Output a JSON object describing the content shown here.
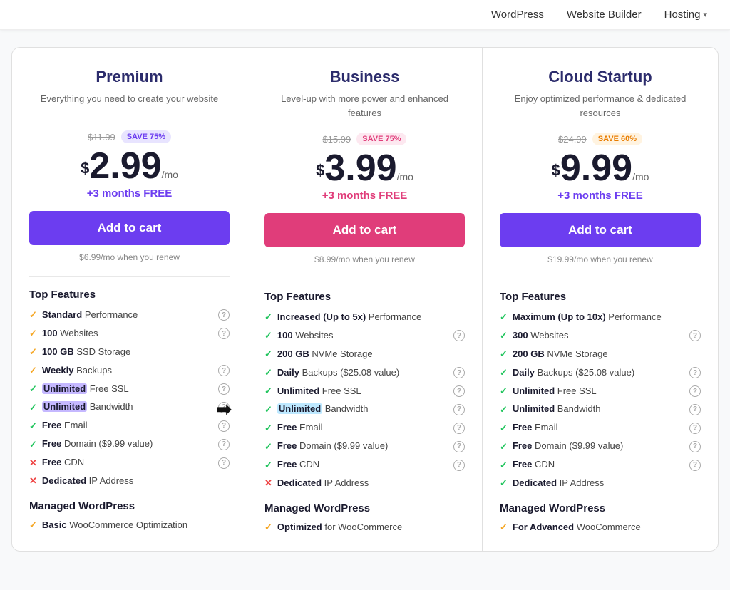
{
  "nav": {
    "items": [
      {
        "label": "WordPress",
        "id": "wordpress"
      },
      {
        "label": "Website Builder",
        "id": "website-builder"
      },
      {
        "label": "Hosting",
        "id": "hosting",
        "hasChevron": true
      }
    ]
  },
  "plans": [
    {
      "id": "premium",
      "name": "Premium",
      "desc": "Everything you need to create your website",
      "originalPrice": "$11.99",
      "saveBadge": "SAVE 75%",
      "saveBadgeColor": "purple",
      "price": "2.99",
      "pricePer": "/mo",
      "monthsFree": "+3 months FREE",
      "monthsFreeColor": "purple",
      "btnLabel": "Add to cart",
      "btnColor": "purple",
      "renewText": "$6.99/mo when you renew",
      "features": [
        {
          "icon": "check-yellow",
          "text": "<strong>Standard</strong> Performance",
          "info": true
        },
        {
          "icon": "check-yellow",
          "text": "<strong>100</strong> Websites",
          "info": true
        },
        {
          "icon": "check-yellow",
          "text": "<strong>100 GB</strong> SSD Storage",
          "info": false
        },
        {
          "icon": "check-yellow",
          "text": "<strong>Weekly</strong> Backups",
          "info": true
        },
        {
          "icon": "check-green",
          "text": "<span class='highlight'><strong>Unlimited</strong></span> Free SSL",
          "info": true,
          "arrow": true
        },
        {
          "icon": "check-green",
          "text": "<span class='highlight'><strong>Unlimited</strong></span> Bandwidth",
          "info": true
        },
        {
          "icon": "check-green",
          "text": "<strong>Free</strong> Email",
          "info": true
        },
        {
          "icon": "check-green",
          "text": "<strong>Free</strong> Domain ($9.99 value)",
          "info": true
        },
        {
          "icon": "x-red",
          "text": "<strong>Free</strong> CDN",
          "info": true
        },
        {
          "icon": "x-red",
          "text": "<strong>Dedicated</strong> IP Address",
          "info": false
        }
      ],
      "managedWP": "<strong>Basic</strong> WooCommerce Optimization"
    },
    {
      "id": "business",
      "name": "Business",
      "desc": "Level-up with more power and enhanced features",
      "originalPrice": "$15.99",
      "saveBadge": "SAVE 75%",
      "saveBadgeColor": "pink",
      "price": "3.99",
      "pricePer": "/mo",
      "monthsFree": "+3 months FREE",
      "monthsFreeColor": "pink",
      "btnLabel": "Add to cart",
      "btnColor": "pink",
      "renewText": "$8.99/mo when you renew",
      "features": [
        {
          "icon": "check-green",
          "text": "<strong>Increased (Up to 5x)</strong> Performance",
          "info": false
        },
        {
          "icon": "check-green",
          "text": "<strong>100</strong> Websites",
          "info": true
        },
        {
          "icon": "check-green",
          "text": "<strong>200 GB</strong> NVMe Storage",
          "info": false
        },
        {
          "icon": "check-green",
          "text": "<strong>Daily</strong> Backups ($25.08 value)",
          "info": true
        },
        {
          "icon": "check-green",
          "text": "<strong>Unlimited</strong> Free SSL",
          "info": true
        },
        {
          "icon": "check-green",
          "text": "<span class='highlight2'><strong>Unlimited</strong></span> Bandwidth",
          "info": true,
          "arrow": true
        },
        {
          "icon": "check-green",
          "text": "<strong>Free</strong> Email",
          "info": true
        },
        {
          "icon": "check-green",
          "text": "<strong>Free</strong> Domain ($9.99 value)",
          "info": true
        },
        {
          "icon": "check-green",
          "text": "<strong>Free</strong> CDN",
          "info": true
        },
        {
          "icon": "x-red",
          "text": "<strong>Dedicated</strong> IP Address",
          "info": false
        }
      ],
      "managedWP": "<strong>Optimized</strong> for WooCommerce"
    },
    {
      "id": "cloud-startup",
      "name": "Cloud Startup",
      "desc": "Enjoy optimized performance & dedicated resources",
      "originalPrice": "$24.99",
      "saveBadge": "SAVE 60%",
      "saveBadgeColor": "yellow",
      "price": "9.99",
      "pricePer": "/mo",
      "monthsFree": "+3 months FREE",
      "monthsFreeColor": "purple",
      "btnLabel": "Add to cart",
      "btnColor": "purple",
      "renewText": "$19.99/mo when you renew",
      "features": [
        {
          "icon": "check-green",
          "text": "<strong>Maximum (Up to 10x)</strong> Performance",
          "info": false
        },
        {
          "icon": "check-green",
          "text": "<strong>300</strong> Websites",
          "info": true
        },
        {
          "icon": "check-green",
          "text": "<strong>200 GB</strong> NVMe Storage",
          "info": false
        },
        {
          "icon": "check-green",
          "text": "<strong>Daily</strong> Backups ($25.08 value)",
          "info": true
        },
        {
          "icon": "check-green",
          "text": "<strong>Unlimited</strong> Free SSL",
          "info": true
        },
        {
          "icon": "check-green",
          "text": "<strong>Unlimited</strong> Bandwidth",
          "info": true
        },
        {
          "icon": "check-green",
          "text": "<strong>Free</strong> Email",
          "info": true
        },
        {
          "icon": "check-green",
          "text": "<strong>Free</strong> Domain ($9.99 value)",
          "info": true
        },
        {
          "icon": "check-green",
          "text": "<strong>Free</strong> CDN",
          "info": true
        },
        {
          "icon": "check-green",
          "text": "<strong>Dedicated</strong> IP Address",
          "info": false
        }
      ],
      "managedWP": "<strong>For Advanced</strong> WooCommerce"
    }
  ],
  "labels": {
    "topFeatures": "Top Features",
    "managedWP": "Managed WordPress"
  }
}
